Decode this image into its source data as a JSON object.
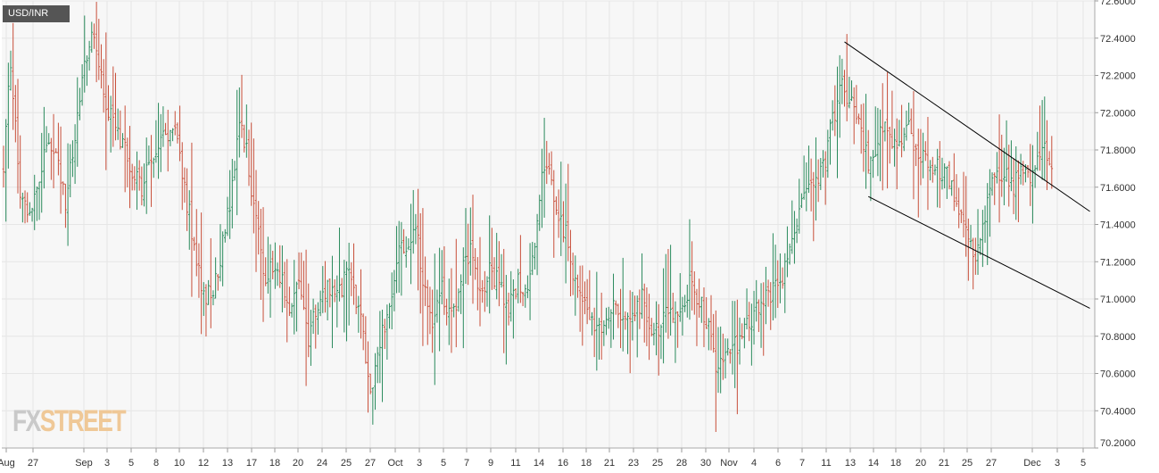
{
  "symbol": "USD/INR",
  "watermark": {
    "part1": "FX",
    "part2": "STREET"
  },
  "colors": {
    "up": "#2a8a5c",
    "down": "#c84f3a",
    "grid": "#e6e6e6",
    "plot_bg": "#f7f7f7",
    "trendline": "#000000"
  },
  "chart_data": {
    "type": "ohlc",
    "ylim": [
      70.2,
      72.6
    ],
    "y_ticks": [
      "72.6000",
      "72.4000",
      "72.2000",
      "72.0000",
      "71.8000",
      "71.6000",
      "71.4000",
      "71.2000",
      "71.0000",
      "70.8000",
      "70.6000",
      "70.4000",
      "70.2000"
    ],
    "x_tick_labels": [
      "Aug",
      "27",
      "Sep",
      "3",
      "5",
      "8",
      "10",
      "12",
      "13",
      "17",
      "18",
      "20",
      "24",
      "25",
      "27",
      "Oct",
      "3",
      "5",
      "7",
      "9",
      "11",
      "14",
      "16",
      "18",
      "21",
      "23",
      "25",
      "28",
      "30",
      "Nov",
      "4",
      "6",
      "7",
      "11",
      "13",
      "14",
      "18",
      "20",
      "21",
      "25",
      "27",
      "Dec",
      "3",
      "5"
    ],
    "grid": true,
    "legend": "none",
    "trendlines": [
      {
        "label": "upper",
        "from": {
          "bar": 353,
          "price": 72.38
        },
        "to": {
          "bar": 456,
          "price": 71.47
        }
      },
      {
        "label": "lower",
        "from": {
          "bar": 363,
          "price": 71.55
        },
        "to": {
          "bar": 456,
          "price": 70.95
        }
      }
    ],
    "anchors": [
      [
        0,
        71.7
      ],
      [
        3,
        72.3
      ],
      [
        7,
        71.55
      ],
      [
        12,
        71.45
      ],
      [
        18,
        71.85
      ],
      [
        22,
        71.75
      ],
      [
        26,
        71.5
      ],
      [
        30,
        71.85
      ],
      [
        34,
        72.25
      ],
      [
        38,
        72.45
      ],
      [
        42,
        72.1
      ],
      [
        46,
        71.95
      ],
      [
        50,
        71.85
      ],
      [
        54,
        71.7
      ],
      [
        58,
        71.6
      ],
      [
        62,
        71.75
      ],
      [
        66,
        71.85
      ],
      [
        72,
        71.95
      ],
      [
        76,
        71.6
      ],
      [
        80,
        71.3
      ],
      [
        84,
        71.0
      ],
      [
        88,
        71.05
      ],
      [
        92,
        71.3
      ],
      [
        96,
        71.6
      ],
      [
        99,
        71.95
      ],
      [
        102,
        71.8
      ],
      [
        106,
        71.4
      ],
      [
        110,
        71.1
      ],
      [
        114,
        71.2
      ],
      [
        118,
        71.05
      ],
      [
        121,
        70.95
      ],
      [
        124,
        71.1
      ],
      [
        128,
        70.8
      ],
      [
        132,
        70.95
      ],
      [
        136,
        71.1
      ],
      [
        140,
        71.0
      ],
      [
        144,
        71.15
      ],
      [
        148,
        71.0
      ],
      [
        151,
        70.8
      ],
      [
        154,
        70.5
      ],
      [
        157,
        70.7
      ],
      [
        160,
        70.85
      ],
      [
        164,
        71.1
      ],
      [
        167,
        71.3
      ],
      [
        170,
        71.25
      ],
      [
        173,
        71.4
      ],
      [
        176,
        71.1
      ],
      [
        180,
        70.9
      ],
      [
        184,
        71.05
      ],
      [
        188,
        70.9
      ],
      [
        192,
        71.1
      ],
      [
        196,
        71.3
      ],
      [
        200,
        71.05
      ],
      [
        204,
        71.15
      ],
      [
        208,
        71.1
      ],
      [
        212,
        70.95
      ],
      [
        216,
        71.1
      ],
      [
        220,
        71.05
      ],
      [
        223,
        71.3
      ],
      [
        226,
        71.7
      ],
      [
        229,
        71.75
      ],
      [
        232,
        71.5
      ],
      [
        236,
        71.35
      ],
      [
        240,
        71.1
      ],
      [
        244,
        70.95
      ],
      [
        248,
        70.85
      ],
      [
        252,
        70.8
      ],
      [
        256,
        71.0
      ],
      [
        260,
        70.85
      ],
      [
        264,
        70.9
      ],
      [
        268,
        71.0
      ],
      [
        272,
        70.8
      ],
      [
        276,
        70.85
      ],
      [
        280,
        70.95
      ],
      [
        284,
        70.9
      ],
      [
        288,
        71.1
      ],
      [
        292,
        71.0
      ],
      [
        296,
        70.85
      ],
      [
        300,
        70.6
      ],
      [
        304,
        70.7
      ],
      [
        308,
        70.75
      ],
      [
        312,
        70.85
      ],
      [
        316,
        70.95
      ],
      [
        320,
        71.0
      ],
      [
        324,
        71.05
      ],
      [
        328,
        71.15
      ],
      [
        332,
        71.4
      ],
      [
        336,
        71.55
      ],
      [
        340,
        71.6
      ],
      [
        344,
        71.7
      ],
      [
        348,
        71.95
      ],
      [
        352,
        72.15
      ],
      [
        356,
        72.05
      ],
      [
        360,
        71.9
      ],
      [
        364,
        71.7
      ],
      [
        368,
        71.95
      ],
      [
        372,
        71.85
      ],
      [
        376,
        71.8
      ],
      [
        380,
        71.9
      ],
      [
        384,
        71.75
      ],
      [
        388,
        71.75
      ],
      [
        392,
        71.7
      ],
      [
        396,
        71.65
      ],
      [
        400,
        71.5
      ],
      [
        404,
        71.4
      ],
      [
        408,
        71.25
      ],
      [
        412,
        71.45
      ],
      [
        416,
        71.65
      ],
      [
        420,
        71.7
      ],
      [
        424,
        71.6
      ],
      [
        428,
        71.7
      ],
      [
        432,
        71.65
      ],
      [
        436,
        71.8
      ],
      [
        440,
        71.75
      ]
    ],
    "last_bar": 440
  }
}
